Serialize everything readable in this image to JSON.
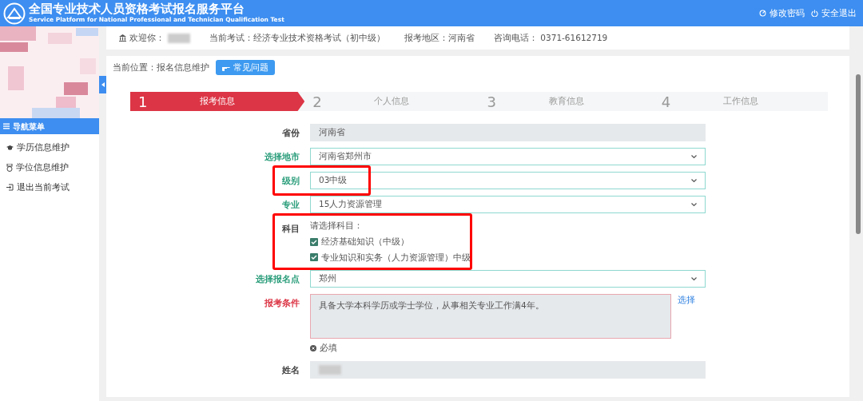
{
  "header": {
    "title": "全国专业技术人员资格考试报名服务平台",
    "subtitle": "Service Platform for National Professional and Technician Qualification Test",
    "links": [
      "修改密码",
      "安全退出"
    ]
  },
  "sidebar": {
    "menu_title": "导航菜单",
    "items": [
      {
        "label": "学历信息维护"
      },
      {
        "label": "学位信息维护"
      },
      {
        "label": "退出当前考试"
      }
    ]
  },
  "info_bar": {
    "welcome": "欢迎你：",
    "exam": "当前考试：经济专业技术资格考试（初中级）",
    "region": "报考地区：河南省",
    "phone": "咨询电话： 0371-61612719"
  },
  "breadcrumb": {
    "text": "当前位置：报名信息维护",
    "button": "常见问题"
  },
  "steps": [
    {
      "number": "1",
      "label": "报考信息",
      "selected": true
    },
    {
      "number": "2",
      "label": "个人信息",
      "selected": false
    },
    {
      "number": "3",
      "label": "教育信息",
      "selected": false
    },
    {
      "number": "4",
      "label": "工作信息",
      "selected": false
    }
  ],
  "form": [
    {
      "kind": "readonly",
      "label": "省份",
      "value": "河南省",
      "color": "#444444"
    },
    {
      "kind": "select",
      "label": "选择地市",
      "value": "河南省郑州市",
      "color": "#2a9d7a"
    },
    {
      "kind": "select",
      "label": "级别",
      "value": "03中级",
      "color": "#2a9d7a",
      "highlighted": true
    },
    {
      "kind": "select",
      "label": "专业",
      "value": "15人力资源管理",
      "color": "#2a9d7a"
    },
    {
      "kind": "checks",
      "label": "科目",
      "prompt": "请选择科目：",
      "color": "#444444",
      "highlighted": true,
      "options": [
        {
          "label": "经济基础知识（中级）",
          "checked": true
        },
        {
          "label": "专业知识和实务（人力资源管理）中级",
          "checked": true
        }
      ]
    },
    {
      "kind": "select",
      "label": "选择报名点",
      "value": "郑州",
      "color": "#2a9d7a"
    },
    {
      "kind": "textarea",
      "label": "报考条件",
      "value": "具备大学本科学历或学士学位，从事相关专业工作满4年。",
      "color": "#dc3545",
      "link": "选择",
      "note": "必填"
    },
    {
      "kind": "readonly",
      "label": "姓名",
      "color": "#444444",
      "blurred": true
    }
  ]
}
